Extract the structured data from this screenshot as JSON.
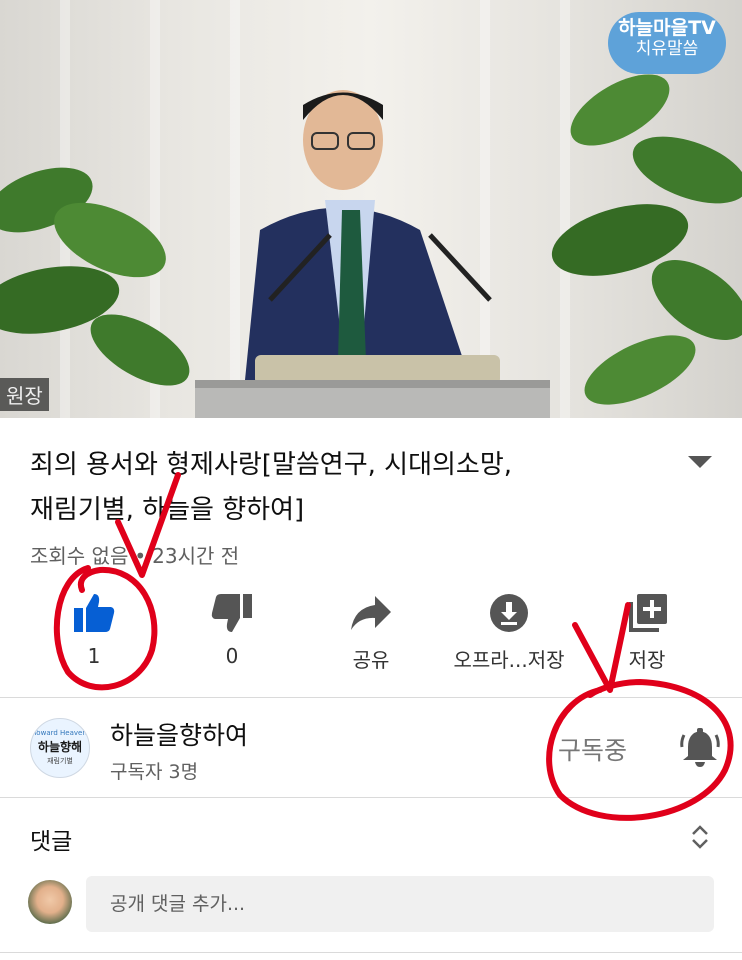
{
  "video": {
    "watermark_line1": "하늘마을TV",
    "watermark_line2": "치유말씀",
    "edge_caption": "원장"
  },
  "details": {
    "title_line1": "죄의 용서와 형제사랑[말씀연구, 시대의소망,",
    "title_line2": "재림기별, 하늘을 향하여]",
    "views": "조회수 없음",
    "separator": "•",
    "age": "23시간 전"
  },
  "actions": [
    {
      "icon": "thumbs-up-icon",
      "label": "1"
    },
    {
      "icon": "thumbs-down-icon",
      "label": "0"
    },
    {
      "icon": "share-icon",
      "label": "공유"
    },
    {
      "icon": "download-icon",
      "label": "오프라...저장"
    },
    {
      "icon": "save-playlist-icon",
      "label": "저장"
    }
  ],
  "channel": {
    "avatar_line1": "Toward Heaven",
    "avatar_line2": "하늘향해",
    "avatar_line3": "재림기별",
    "name": "하늘을향하여",
    "subscribers": "구독자 3명",
    "subscribe_state": "구독중",
    "bell_icon": "bell-icon"
  },
  "comments": {
    "header": "댓글",
    "sort_icon": "unfold-icon",
    "placeholder": "공개 댓글 추가..."
  },
  "colors": {
    "like_active": "#065fd4",
    "annotation": "#e0001a",
    "watermark_bg": "#5ea2d9"
  }
}
